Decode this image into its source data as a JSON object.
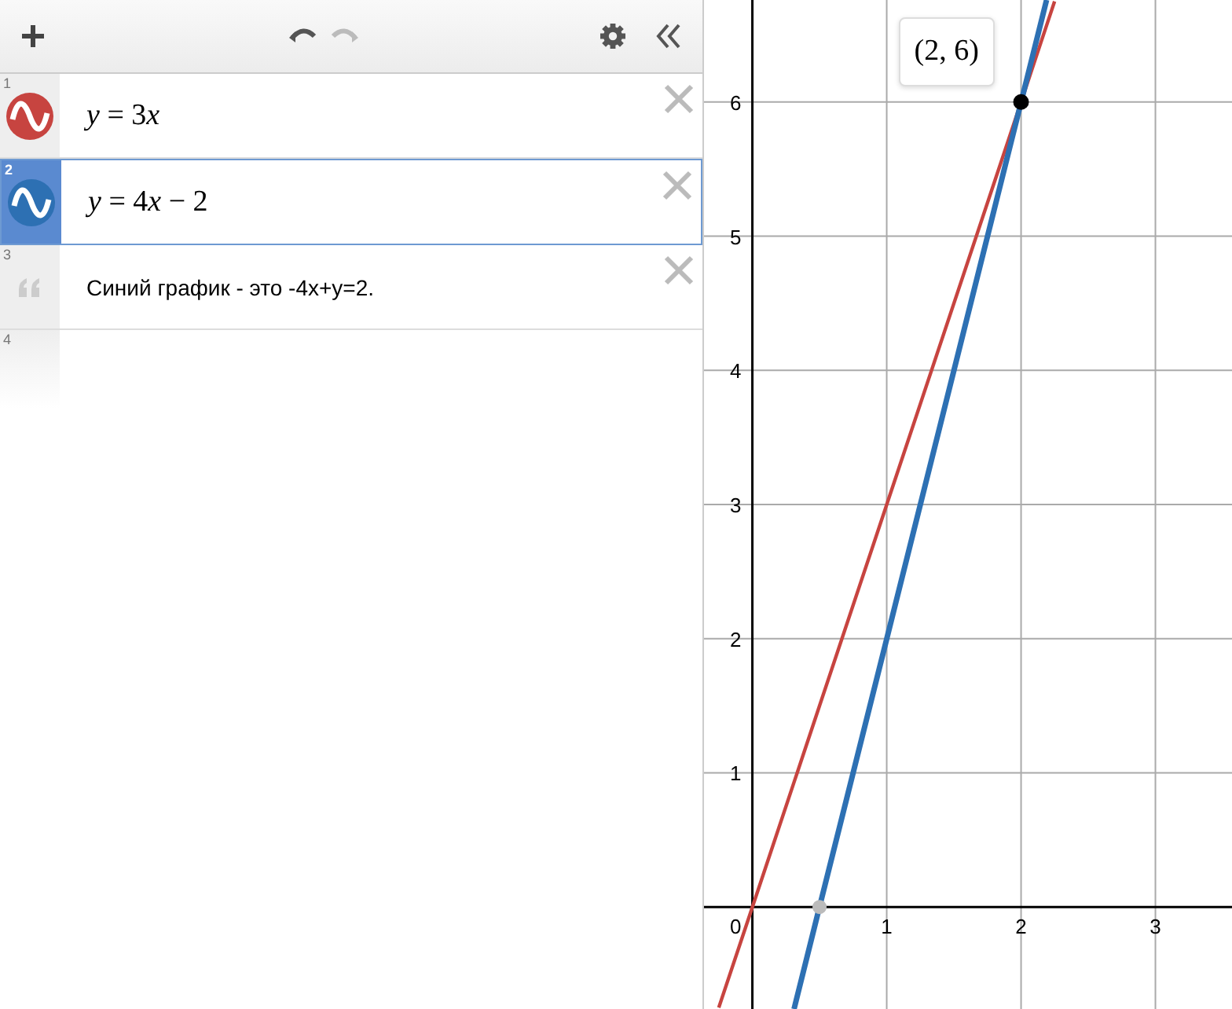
{
  "toolbar": {
    "buttons": [
      {
        "kind": "add",
        "disabled": false
      },
      {
        "kind": "undo",
        "disabled": false
      },
      {
        "kind": "redo",
        "disabled": true
      },
      {
        "kind": "settings",
        "disabled": false
      },
      {
        "kind": "collapse",
        "disabled": false
      }
    ]
  },
  "expressions": [
    {
      "number": "1",
      "kind": "expression",
      "text": "y = 3x",
      "color": "#c74440",
      "selected": false
    },
    {
      "number": "2",
      "kind": "expression",
      "text": "y = 4x − 2",
      "color": "#2d70b3",
      "selected": true
    },
    {
      "number": "3",
      "kind": "note",
      "text": "Синий график - это -4x+y=2.",
      "selected": false
    },
    {
      "number": "4",
      "kind": "empty",
      "selected": false
    }
  ],
  "graph": {
    "origin_label": "0",
    "chart_data": {
      "type": "line",
      "x": [
        -0.25,
        0,
        0.31,
        0.5,
        1,
        2,
        2.19,
        2.25
      ],
      "series": [
        {
          "color": "#c74440",
          "values": [
            -0.75,
            0,
            0.93,
            1.5,
            3,
            6,
            6.57,
            6.75
          ]
        },
        {
          "color": "#2d70b3",
          "values": [
            null,
            null,
            -0.76,
            0,
            2,
            6,
            6.76,
            null
          ]
        }
      ],
      "xlim": [
        -0.36,
        3.57
      ],
      "ylim": [
        -0.76,
        6.76
      ],
      "xticks": [
        {
          "value": 1,
          "label": "1"
        },
        {
          "value": 2,
          "label": "2"
        },
        {
          "value": 3,
          "label": "3"
        }
      ],
      "yticks": [
        {
          "value": 1,
          "label": "1"
        },
        {
          "value": 2,
          "label": "2"
        },
        {
          "value": 3,
          "label": "3"
        },
        {
          "value": 4,
          "label": "4"
        },
        {
          "value": 5,
          "label": "5"
        },
        {
          "value": 6,
          "label": "6"
        }
      ],
      "grid": true,
      "annotations": [
        {
          "x": 2,
          "y": 6,
          "text": "(2, 6)"
        }
      ]
    }
  }
}
